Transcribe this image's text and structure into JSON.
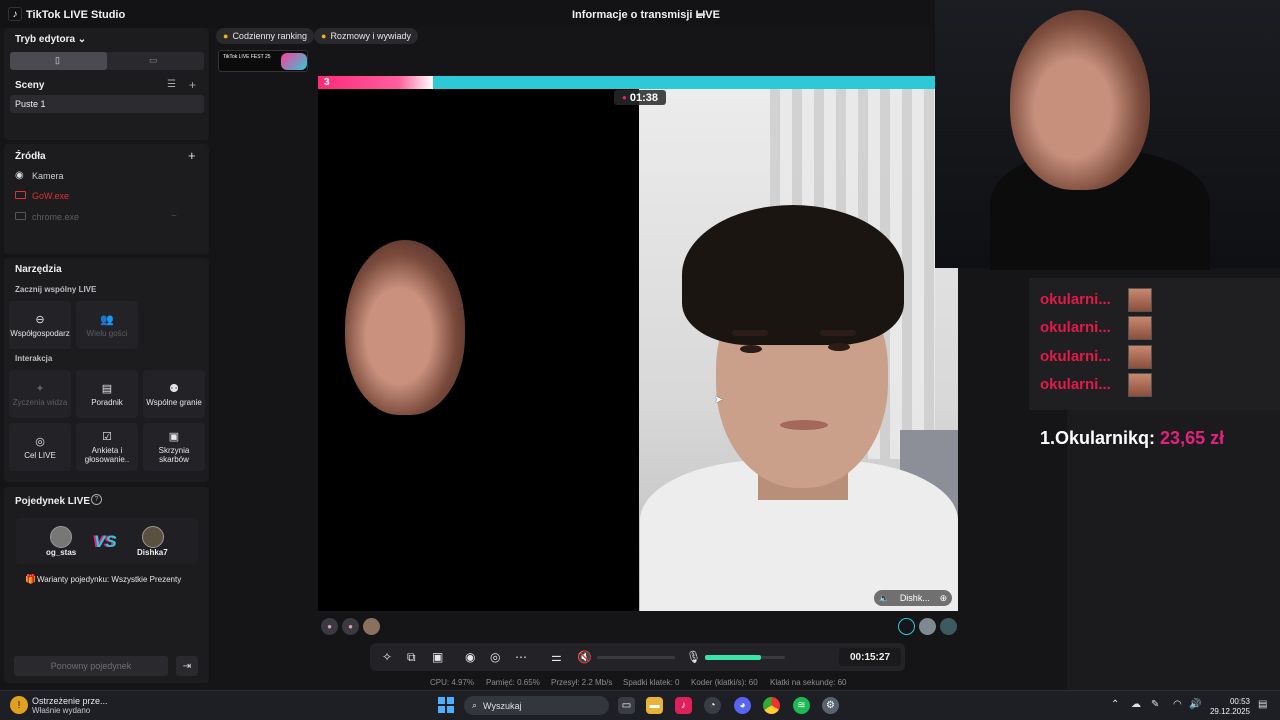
{
  "app": {
    "title": "TikTok LIVE Studio",
    "live_info": "Informacje o transmisji LIVE"
  },
  "sidebar": {
    "editor_mode": "Tryb edytora",
    "scenes": {
      "header": "Sceny",
      "items": [
        "Puste 1"
      ]
    },
    "sources": {
      "header": "Źródła",
      "items": [
        "Kamera",
        "GoW.exe",
        "chrome.exe"
      ]
    },
    "tools": {
      "header": "Narzędzia",
      "start_collab": "Zacznij wspólny LIVE",
      "collab_buttons": [
        "Współgospodarz",
        "Wielu gości"
      ],
      "interaction": "Interakcja",
      "interaction_buttons": [
        "Życzenia widza",
        "Poradnik",
        "Wspólne granie",
        "Cel LIVE",
        "Ankieta i głosowanie..",
        "Skrzynia skarbów"
      ]
    },
    "battle": {
      "header": "Pojedynek LIVE",
      "player1": "og_stas",
      "vs": "VS",
      "player2": "Dishka7",
      "variants": "Warianty pojedynku: Wszystkie Prezenty",
      "rematch": "Ponowny pojedynek"
    }
  },
  "chips": [
    "Codzienny ranking",
    "Rozmowy i wywiady"
  ],
  "fest_badge": "TikTok LIVE FEST 25",
  "stream": {
    "score_left": "3",
    "timer": "01:38",
    "guest_name": "Dishk..."
  },
  "donors": {
    "rows": [
      "okularni...",
      "okularni...",
      "okularni...",
      "okularni..."
    ],
    "rank_label": "1.Okularnikq:",
    "rank_amount": "23,65 zł"
  },
  "controls": {
    "elapsed": "00:15:27"
  },
  "stats": {
    "cpu": "CPU: 4.97%",
    "memory": "Pamięć: 0.65%",
    "bitrate": "Przesył: 2.2 Mb/s",
    "dropped": "Spadki klatek: 0",
    "encoder": "Koder (klatki/s): 60",
    "fps": "Klatki na sekundę: 60"
  },
  "taskbar": {
    "notify_title": "Ostrzeżenie prze...",
    "notify_sub": "Właśnie wydano",
    "search": "Wyszukaj",
    "time": "00:53",
    "date": "29.12.2025"
  },
  "colors": {
    "accent_pink": "#e4207e",
    "donor_red": "#e21a4a",
    "cyan": "#2ec9d7",
    "mic_green": "#38e6a8"
  }
}
